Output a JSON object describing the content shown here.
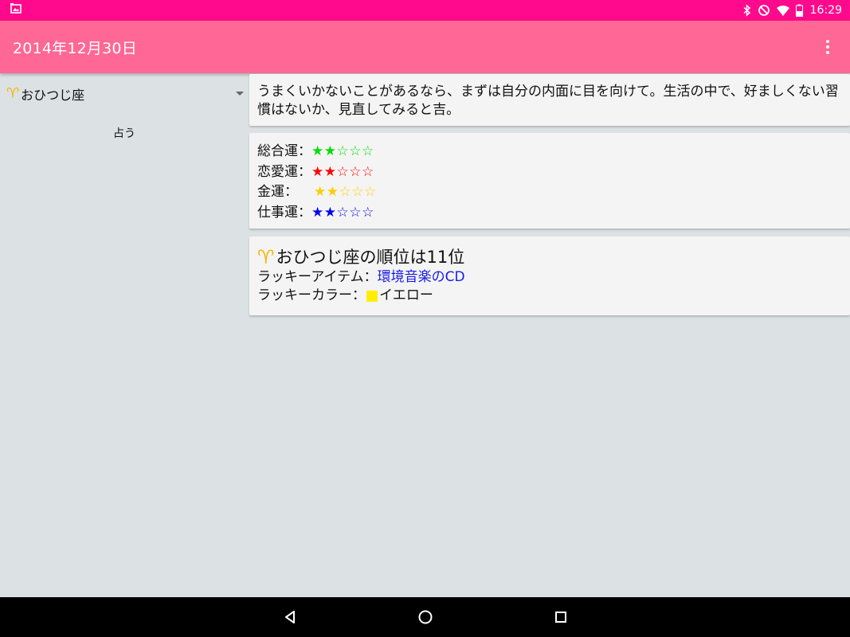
{
  "status_bar": {
    "time": "16:29",
    "icons": [
      "screenshot-icon",
      "bluetooth-icon",
      "do-not-disturb-icon",
      "wifi-icon",
      "battery-icon"
    ]
  },
  "app_bar": {
    "title": "2014年12月30日",
    "overflow_icon": "more-vert-icon"
  },
  "left_pane": {
    "sign_selector": {
      "glyph": "♈",
      "label": "おひつじ座"
    },
    "fortune_button_label": "占う"
  },
  "message_card": {
    "text": "うまくいかないことがあるなら、まずは自分の内面に目を向けて。生活の中で、好ましくない習慣はないか、見直してみると吉。"
  },
  "luck_card": {
    "rows": [
      {
        "label": "総合運：",
        "stars_filled": "★★",
        "stars_empty": "☆☆☆",
        "rating": 2,
        "max": 5,
        "color": "#00dd00"
      },
      {
        "label": "恋愛運：",
        "stars_filled": "★★",
        "stars_empty": "☆☆☆",
        "rating": 2,
        "max": 5,
        "color": "#ff0000"
      },
      {
        "label": "金運：",
        "stars_filled": "★★",
        "stars_empty": "☆☆☆",
        "rating": 2,
        "max": 5,
        "color": "#ffcc00"
      },
      {
        "label": "仕事運：",
        "stars_filled": "★★",
        "stars_empty": "☆☆☆",
        "rating": 2,
        "max": 5,
        "color": "#0000ee"
      }
    ]
  },
  "rank_card": {
    "glyph": "♈",
    "rank_text": "おひつじ座の順位は11位",
    "lucky_item_label": "ラッキーアイテム：",
    "lucky_item_value": "環境音楽のCD",
    "lucky_color_label": "ラッキーカラー：",
    "lucky_color_swatch": "#ffee00",
    "lucky_color_value": "イエロー"
  },
  "nav_bar": {
    "buttons": [
      "back-icon",
      "home-icon",
      "recents-icon"
    ]
  },
  "colors": {
    "status_bar": "#ff0a8c",
    "app_bar": "#ff6796",
    "background": "#dce1e3",
    "card": "#f4f4f4",
    "sign_glyph": "#f6b500",
    "link_blue": "#1a1ae6"
  }
}
